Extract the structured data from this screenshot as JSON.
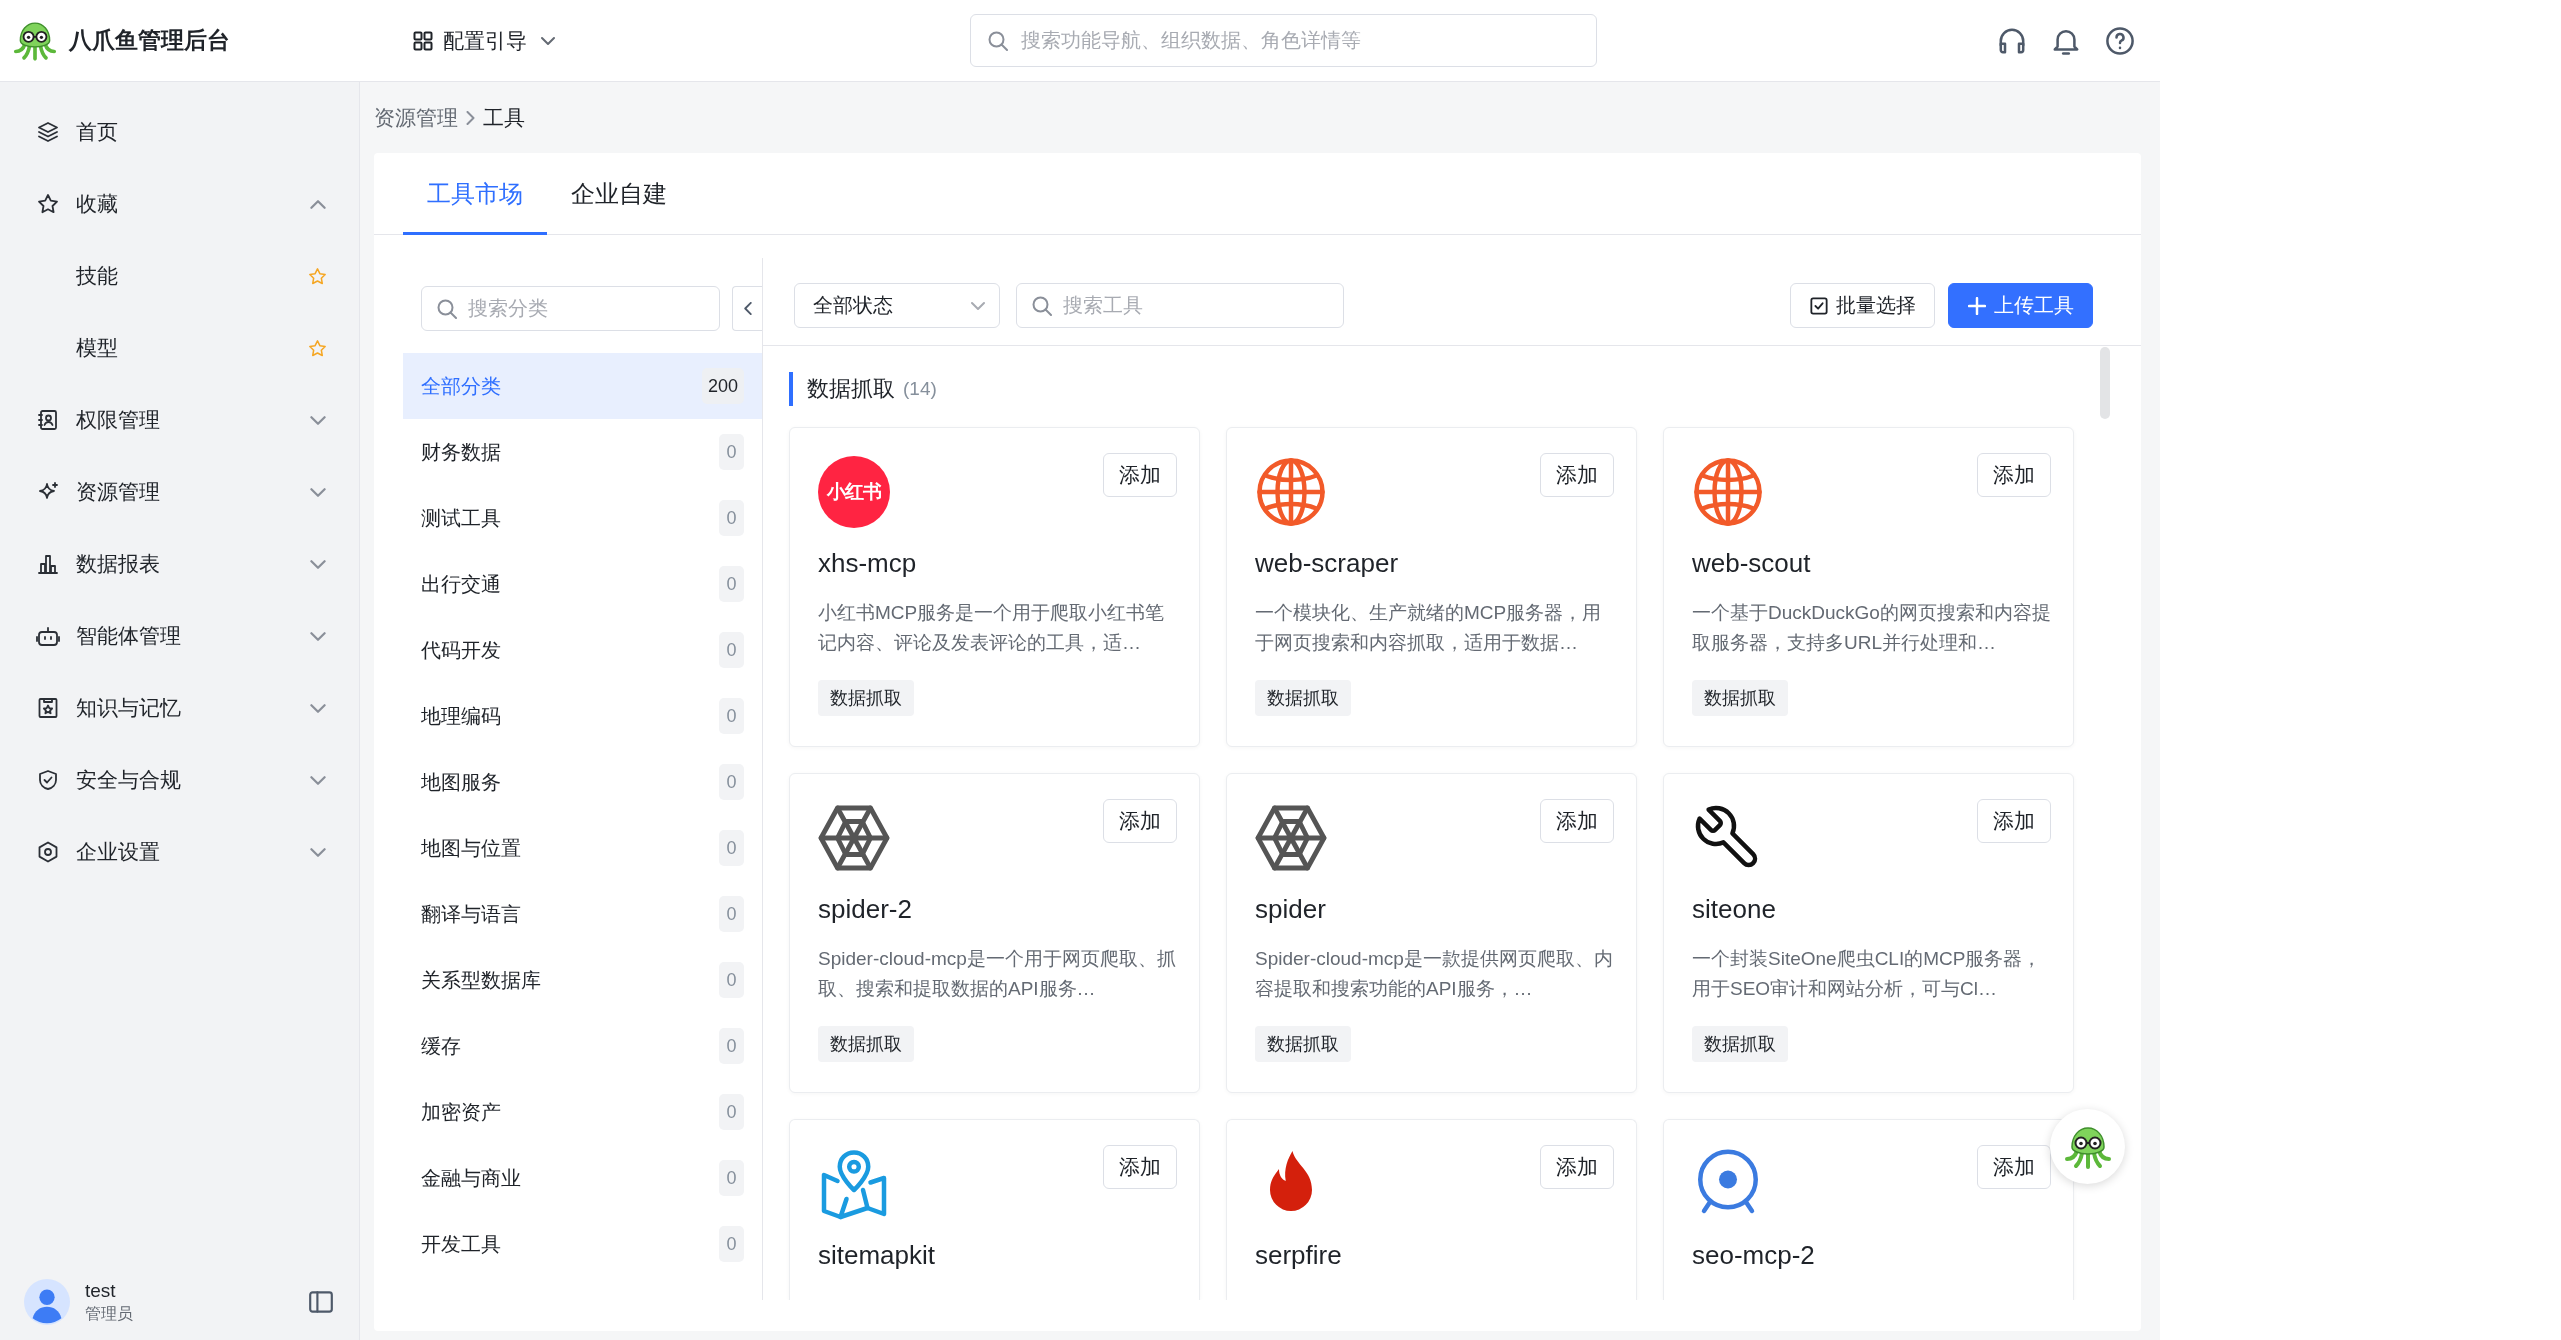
{
  "app": {
    "title": "八爪鱼管理后台"
  },
  "header": {
    "guide": "配置引导",
    "search": {
      "placeholder": "搜索功能导航、组织数据、角色详情等"
    }
  },
  "sidebar": {
    "items": [
      {
        "label": "首页",
        "kind": "link"
      },
      {
        "label": "收藏",
        "kind": "group",
        "expanded": true,
        "children": [
          {
            "label": "技能"
          },
          {
            "label": "模型"
          }
        ]
      },
      {
        "label": "权限管理",
        "kind": "group",
        "expanded": false
      },
      {
        "label": "资源管理",
        "kind": "group",
        "expanded": false
      },
      {
        "label": "数据报表",
        "kind": "group",
        "expanded": false
      },
      {
        "label": "智能体管理",
        "kind": "group",
        "expanded": false
      },
      {
        "label": "知识与记忆",
        "kind": "group",
        "expanded": false
      },
      {
        "label": "安全与合规",
        "kind": "group",
        "expanded": false
      },
      {
        "label": "企业设置",
        "kind": "group",
        "expanded": false
      }
    ],
    "user": {
      "name": "test",
      "role": "管理员"
    }
  },
  "breadcrumb": [
    "资源管理",
    "工具"
  ],
  "tabs": [
    {
      "label": "工具市场",
      "selected": true
    },
    {
      "label": "企业自建",
      "selected": false
    }
  ],
  "categories": {
    "search": {
      "placeholder": "搜索分类"
    },
    "items": [
      {
        "label": "全部分类",
        "count": "200",
        "selected": true
      },
      {
        "label": "财务数据",
        "count": "0",
        "selected": false
      },
      {
        "label": "测试工具",
        "count": "0",
        "selected": false
      },
      {
        "label": "出行交通",
        "count": "0",
        "selected": false
      },
      {
        "label": "代码开发",
        "count": "0",
        "selected": false
      },
      {
        "label": "地理编码",
        "count": "0",
        "selected": false
      },
      {
        "label": "地图服务",
        "count": "0",
        "selected": false
      },
      {
        "label": "地图与位置",
        "count": "0",
        "selected": false
      },
      {
        "label": "翻译与语言",
        "count": "0",
        "selected": false
      },
      {
        "label": "关系型数据库",
        "count": "0",
        "selected": false
      },
      {
        "label": "缓存",
        "count": "0",
        "selected": false
      },
      {
        "label": "加密资产",
        "count": "0",
        "selected": false
      },
      {
        "label": "金融与商业",
        "count": "0",
        "selected": false
      },
      {
        "label": "开发工具",
        "count": "0",
        "selected": false
      }
    ]
  },
  "toolbar": {
    "status_filter": "全部状态",
    "search": {
      "placeholder": "搜索工具"
    },
    "buttons": [
      {
        "label": "批量选择",
        "kind": "outline"
      },
      {
        "label": "上传工具",
        "kind": "primary"
      }
    ]
  },
  "section": {
    "title": "数据抓取",
    "count": "(14)"
  },
  "tools": [
    {
      "name": "xhs-mcp",
      "logo_text": "小红书",
      "description": "小红书MCP服务是一个用于爬取小红书笔记内容、评论及发表评论的工具，适…",
      "tag": "数据抓取",
      "action": "添加"
    },
    {
      "name": "web-scraper",
      "description": "一个模块化、生产就绪的MCP服务器，用于网页搜索和内容抓取，适用于数据…",
      "tag": "数据抓取",
      "action": "添加"
    },
    {
      "name": "web-scout",
      "description": "一个基于DuckDuckGo的网页搜索和内容提取服务器，支持多URL并行处理和…",
      "tag": "数据抓取",
      "action": "添加"
    },
    {
      "name": "spider-2",
      "description": "Spider-cloud-mcp是一个用于网页爬取、抓取、搜索和提取数据的API服务…",
      "tag": "数据抓取",
      "action": "添加"
    },
    {
      "name": "spider",
      "description": "Spider-cloud-mcp是一款提供网页爬取、内容提取和搜索功能的API服务，…",
      "tag": "数据抓取",
      "action": "添加"
    },
    {
      "name": "siteone",
      "description": "一个封装SiteOne爬虫CLI的MCP服务器，用于SEO审计和网站分析，可与Cl…",
      "tag": "数据抓取",
      "action": "添加"
    },
    {
      "name": "sitemapkit",
      "action": "添加"
    },
    {
      "name": "serpfire",
      "action": "添加"
    },
    {
      "name": "seo-mcp-2",
      "action": "添加"
    }
  ]
}
